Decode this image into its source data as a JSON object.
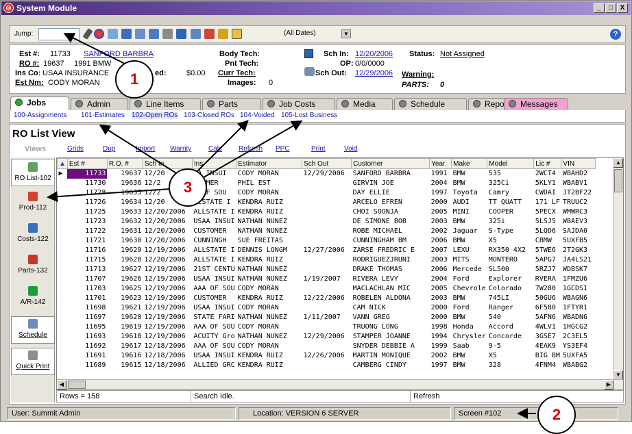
{
  "window": {
    "title": "System Module",
    "minimize": "_",
    "maximize": "□",
    "close": "X"
  },
  "toolbar": {
    "jump_label": "Jump:",
    "jump_value": "",
    "date_filter": "(All Dates)",
    "help": "?"
  },
  "estimate": {
    "est_label": "Est #:",
    "est_value": "11733",
    "customer_link": "SANFORD BARBRA",
    "ro_label": "RO #:",
    "ro_value": "19637",
    "vehicle": "1991 BMW",
    "ins_label": "Ins Co:",
    "ins_value": "USAA INSURANCE",
    "fragment": "ed:",
    "amount": "$0.00",
    "estnm_label": "Est Nm:",
    "estnm_value": "CODY MORAN",
    "body_tech": "Body Tech:",
    "pnt_tech": "Pnt Tech:",
    "curr_tech": "Curr Tech:",
    "images_label": "Images:",
    "images_value": "0",
    "sch_in_label": "Sch In:",
    "sch_in_value": "12/20/2006",
    "op_label": "OP:",
    "op_value": "0/0/0000",
    "sch_out_label": "Sch Out:",
    "sch_out_value": "12/29/2006",
    "status_label": "Status:",
    "status_value": "Not Assigned",
    "warning_label": "Warning:",
    "parts_label": "PARTS:",
    "parts_value": "0"
  },
  "tabs": [
    "Jobs",
    "Admin",
    "Line Items",
    "Parts",
    "Job Costs",
    "Media",
    "Schedule",
    "Reports",
    "Messages"
  ],
  "subtabs": [
    "100-Assignments",
    "101-Estimates",
    "102-Open ROs",
    "103-Closed ROs",
    "104-Voided",
    "105-Lost Business"
  ],
  "view_title": "RO List View",
  "menu": {
    "views": "Views",
    "items": [
      "Grids",
      "Dup",
      "Import",
      "Warnty",
      "Calc",
      "Refresh",
      "PPC",
      "Print",
      "Void"
    ]
  },
  "leftnav": [
    "RO List-102",
    "Prod-112",
    "Costs-122",
    "Parts-132",
    "A/R-142",
    "Schedule",
    "Quick Print"
  ],
  "columns": [
    "Est #",
    "R.O. #",
    "Sch In",
    "Ins",
    "Estimator",
    "Sch Out",
    "Customer",
    "Year",
    "Make",
    "Model",
    "Lic #",
    "VIN"
  ],
  "rows": [
    [
      "11733",
      "19637",
      "12/20",
      "AA INSUI",
      "CODY MORAN",
      "12/29/2006",
      "SANFORD BARBRA",
      "1991",
      "BMW",
      "535",
      "2WCT4",
      "WBAHD2"
    ],
    [
      "11730",
      "19636",
      "12/2",
      "STOMER",
      "PHIL EST",
      "",
      "GIRVIN JOE",
      "2004",
      "BMW",
      "325Ci",
      "5KLY1",
      "WBABV1"
    ],
    [
      "11728",
      "19635",
      "12/2",
      "A OF SOU",
      "CODY MORAN",
      "",
      "DAY ELLIE",
      "1997",
      "Toyota",
      "Camry",
      "CWDAI",
      "JT2BF22"
    ],
    [
      "11726",
      "19634",
      "12/20",
      "LLSTATE I",
      "KENDRA RUIZ",
      "",
      "ARCELO EFREN",
      "2000",
      "AUDI",
      "TT QUATT",
      "171 LF",
      "TRUUC2"
    ],
    [
      "11725",
      "19633",
      "12/20/2006",
      "ALLSTATE I",
      "KENDRA RUIZ",
      "",
      "CHOI SOONJA",
      "2005",
      "MINI",
      "COOPER",
      "5PECX",
      "WMWRC3"
    ],
    [
      "11723",
      "19632",
      "12/20/2006",
      "USAA INSUI",
      "NATHAN NUNEZ",
      "",
      "DE SIMONE BOB",
      "2003",
      "BMW",
      "325i",
      "5LSJ5",
      "WBAEV3"
    ],
    [
      "11722",
      "19631",
      "12/20/2006",
      "CUSTOMER",
      "NATHAN NUNEZ",
      "",
      "ROBE MICHAEL",
      "2002",
      "Jaguar",
      "S-Type",
      "5LQD6",
      "SAJDA0"
    ],
    [
      "11721",
      "19630",
      "12/20/2006",
      "CUNNINGH",
      "SUE FREITAS",
      "",
      "CUNNINGHAM BM",
      "2006",
      "BMW",
      "X5",
      "CBMW",
      "5UXFB5"
    ],
    [
      "11716",
      "19629",
      "12/19/2006",
      "ALLSTATE I",
      "DENNIS LONGM",
      "12/27/2006",
      "ZARSE FREDRIC E",
      "2007",
      "LEXU",
      "RX350 4X2",
      "5TWE6",
      "2T2GK3"
    ],
    [
      "11715",
      "19628",
      "12/20/2006",
      "ALLSTATE I",
      "KENDRA RUIZ",
      "",
      "RODRIGUEZJRUNI",
      "2003",
      "MITS",
      "MONTERO",
      "5APG7",
      "JA4LS21"
    ],
    [
      "11713",
      "19627",
      "12/19/2006",
      "21ST CENTU",
      "NATHAN NUNEZ",
      "",
      "DRAKE THOMAS",
      "2006",
      "Mercede",
      "SL500",
      "5RZJ7",
      "WDBSK7"
    ],
    [
      "11707",
      "19626",
      "12/19/2006",
      "USAA INSUI",
      "NATHAN NUNEZ",
      "1/19/2007",
      "RIVERA LEVY",
      "2004",
      "Ford",
      "Explorer",
      "RVERA",
      "1FMZU6"
    ],
    [
      "11703",
      "19625",
      "12/19/2006",
      "AAA OF SOU",
      "CODY MORAN",
      "",
      "MACLACHLAN MIC",
      "2005",
      "Chevrole",
      "Colorado",
      "7W280",
      "1GCDS1"
    ],
    [
      "11701",
      "19623",
      "12/19/2006",
      "CUSTOMER",
      "KENDRA RUIZ",
      "12/22/2006",
      "ROBELEN ALDONA",
      "2003",
      "BMW",
      "745LI",
      "50GU6",
      "WBAGN6"
    ],
    [
      "11698",
      "19621",
      "12/19/2006",
      "USAA INSUI",
      "CODY MORAN",
      "",
      "CAM NICK",
      "2000",
      "Ford",
      "Ranger",
      "6F580",
      "1FTYR1"
    ],
    [
      "11697",
      "19620",
      "12/19/2006",
      "STATE FARI",
      "NATHAN NUNEZ",
      "1/11/2007",
      "VANN GREG",
      "2000",
      "BMW",
      "540",
      "5AFN6",
      "WBADN6"
    ],
    [
      "11695",
      "19619",
      "12/19/2006",
      "AAA OF SOU",
      "CODY MORAN",
      "",
      "TRUONG LONG",
      "1998",
      "Honda",
      "Accord",
      "4WLV1",
      "1HGCG2"
    ],
    [
      "11693",
      "19618",
      "12/19/2006",
      "ACUITY Gro",
      "NATHAN NUNEZ",
      "12/29/2006",
      "STAMPER JOANNE",
      "1994",
      "Chrysler",
      "Concorde",
      "3GSE7",
      "2C3EL5"
    ],
    [
      "11692",
      "19617",
      "12/18/2006",
      "AAA OF SOU",
      "CODY MORAN",
      "",
      "SNYDER DEBBIE A",
      "1999",
      "Saab",
      "9-5",
      "4EAK9",
      "YS3EF4"
    ],
    [
      "11691",
      "19616",
      "12/18/2006",
      "USAA INSUI",
      "KENDRA RUIZ",
      "12/26/2006",
      "MARTIN MONIQUE",
      "2002",
      "BMW",
      "X5",
      "BIG BM",
      "5UXFA5"
    ],
    [
      "11689",
      "19615",
      "12/18/2006",
      "ALLIED GRC",
      "KENDRA RUIZ",
      "",
      "CAMBERG CINDY",
      "1997",
      "BMW",
      "328",
      "4FNM4",
      "WBABG2"
    ]
  ],
  "grid_status": {
    "rows": "Rows = 158",
    "search": "Search Idle.",
    "refresh": "Refresh"
  },
  "statusbar": {
    "user": "User: Summit Admin",
    "location": "Location: VERSION 6 SERVER",
    "screen": "Screen #102"
  },
  "callouts": [
    "1",
    "2",
    "3"
  ],
  "colors": {
    "title_bar": "#4b2a7a",
    "selected_cell": "#6a0f7c",
    "link": "#1a1ab0",
    "callout_text": "#d40000",
    "active_tab_dot": "#2fa82f"
  }
}
